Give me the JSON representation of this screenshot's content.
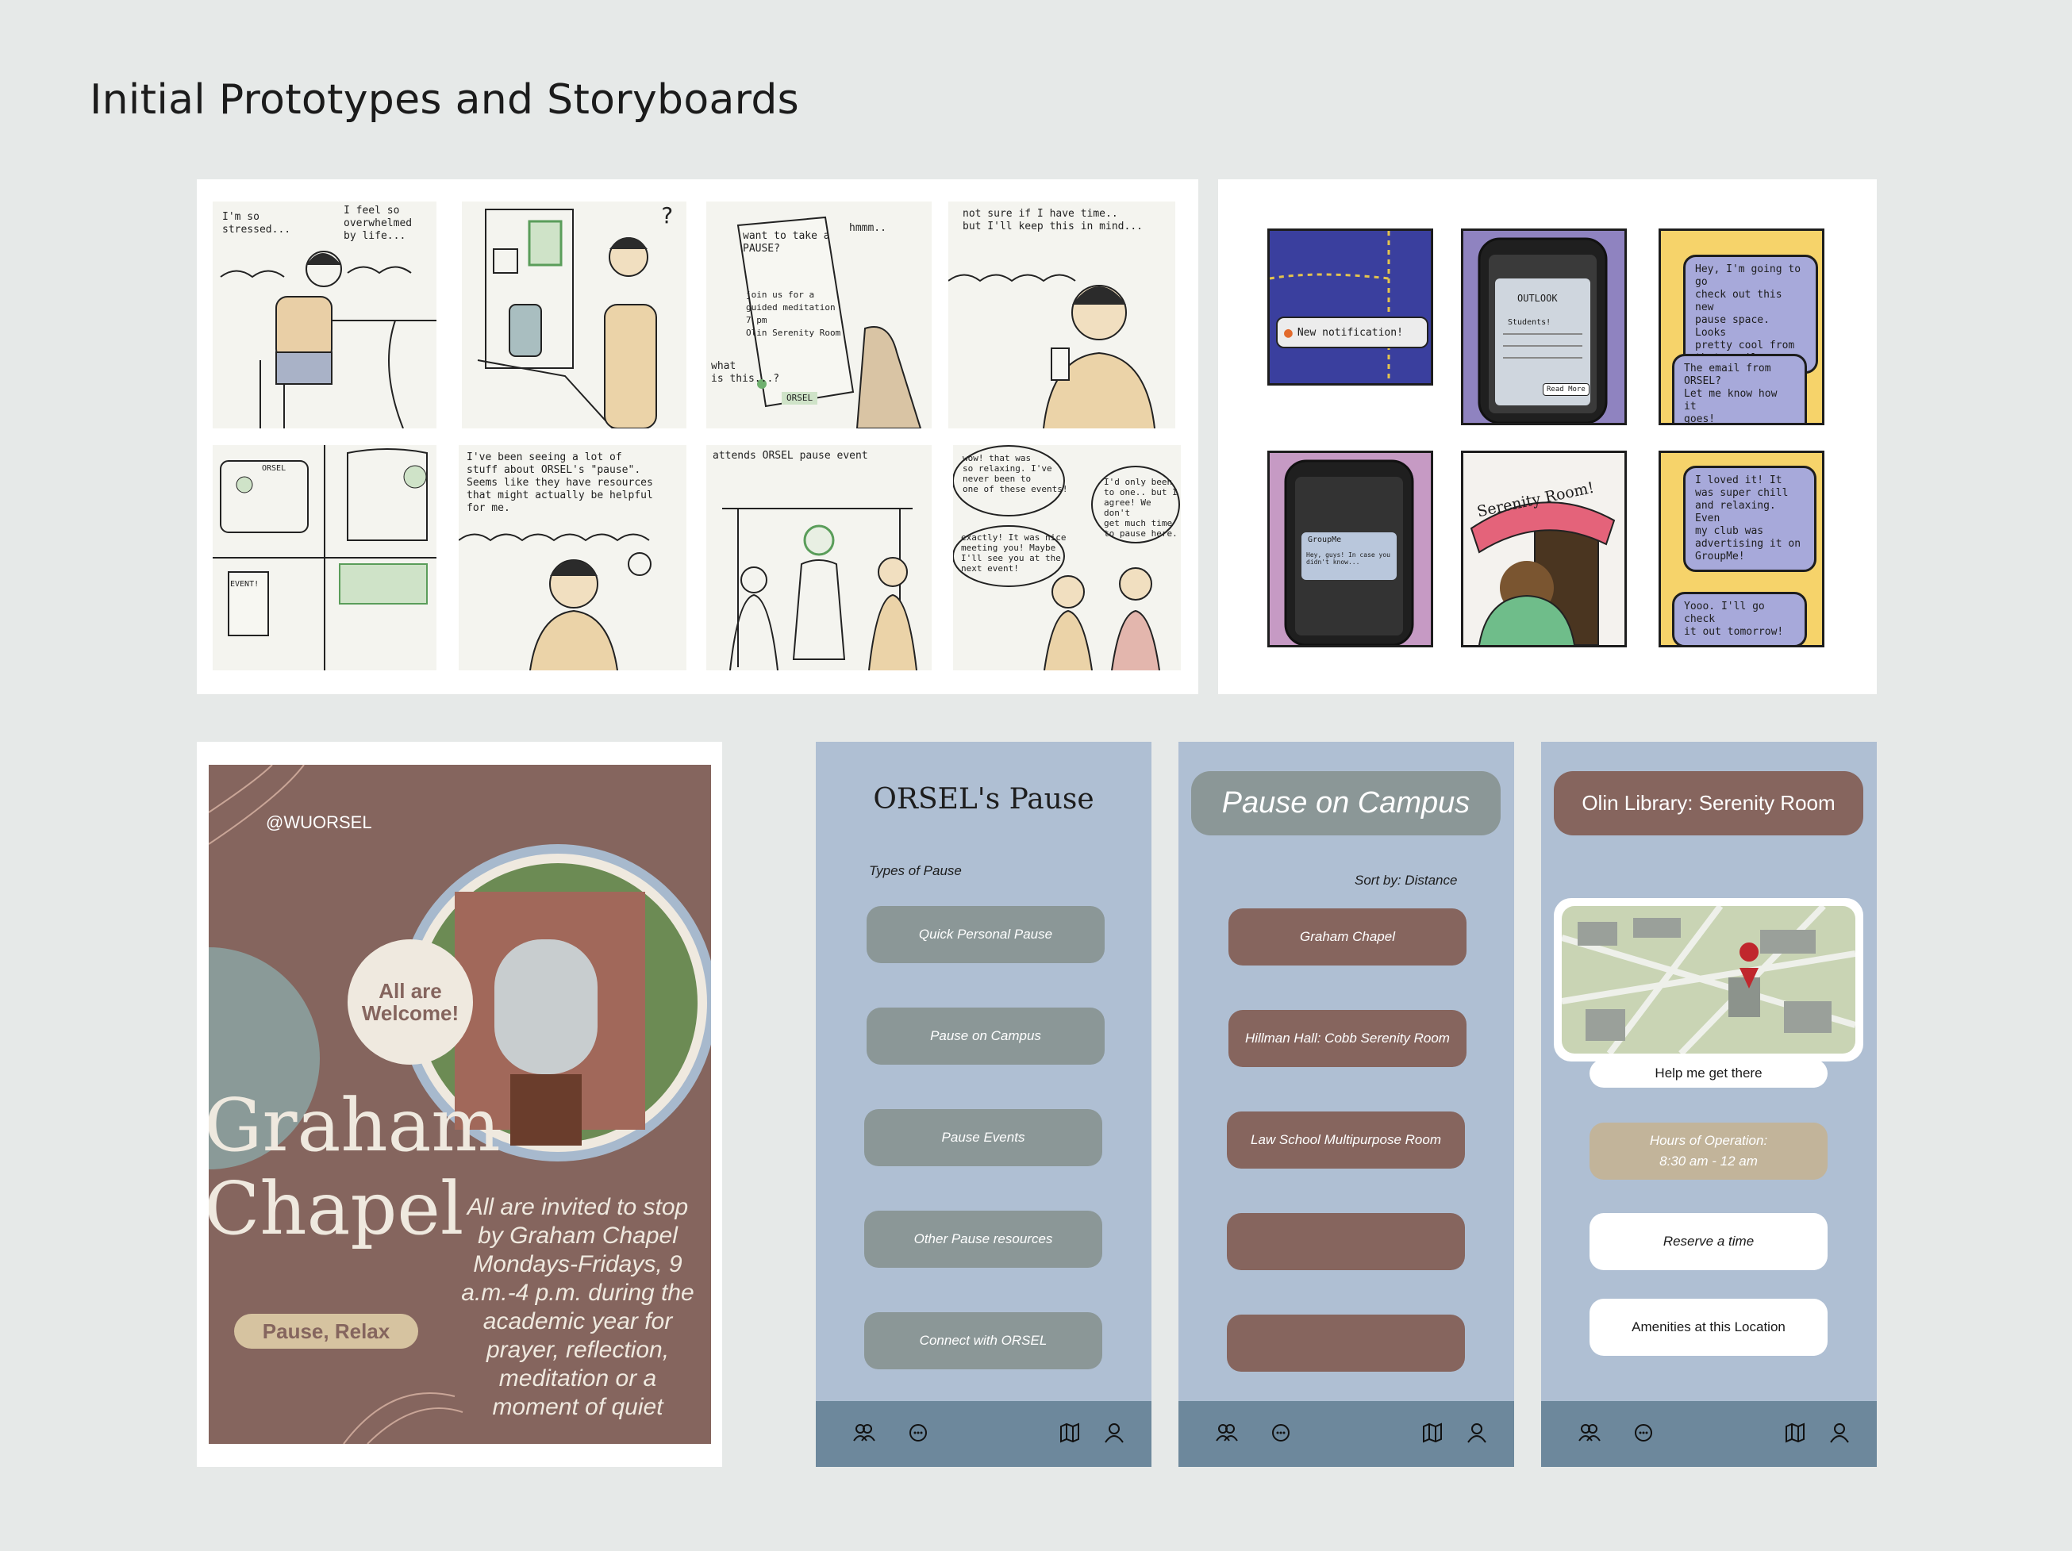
{
  "page": {
    "title": "Initial Prototypes and Storyboards"
  },
  "storyboard": {
    "captions": {
      "c1a": "I'm so\nstressed...",
      "c1b": "I feel so\noverwhelmed\nby life...",
      "c2": "?",
      "c3a": "want to take a\nPAUSE?",
      "c3b": "join us for a\nguided meditation\n7 pm\nOlin Serenity Room",
      "c3c": "hmmm..",
      "c3d": "what\nis this...?",
      "c3tag": "ORSEL",
      "c4": "not sure if I have time..\nbut I'll keep this in mind...",
      "c5a": "ORSEL",
      "c5b": "EVENT!",
      "c6": "I've been seeing a lot of\nstuff about ORSEL's \"pause\".\nSeems like they have resources\nthat might actually be helpful\nfor me.",
      "c7": "attends ORSEL pause event",
      "c8a": "wow! that was\nso relaxing. I've\nnever been to\none of these events!",
      "c8b": "I'd only been\nto one.. but I\nagree! We don't\nget much time\nto pause here.",
      "c8c": "exactly! It was nice\nmeeting you! Maybe\nI'll see you at the\nnext event!"
    }
  },
  "comic": {
    "notification": "New notification!",
    "email_app": "OUTLOOK",
    "email_body": "Students!",
    "read_more": "Read More",
    "groupme": "GroupMe",
    "groupme_msg": "Hey, guys! In case you didn't know...",
    "sign": "Serenity Room!",
    "bubble1": "Hey, I'm going to go\ncheck out this new\npause space. Looks\npretty cool from\nthat email.",
    "bubble2": "The email from ORSEL?\nLet me know how it\ngoes!",
    "bubble3": "I loved it! It\nwas super chill\nand relaxing. Even\nmy club was\nadvertising it on\nGroupMe!",
    "bubble4": "Yooo. I'll go check\nit out tomorrow!"
  },
  "poster": {
    "handle": "@WUORSEL",
    "badge": "All are\nWelcome!",
    "title_line1": "Graham",
    "title_line2": "Chapel",
    "tag": "Pause, Relax",
    "description": "All are invited to stop by Graham Chapel Mondays-Fridays, 9 a.m.-4 p.m. during the academic year for prayer, reflection, meditation or a moment of quiet"
  },
  "phone1": {
    "title": "ORSEL's Pause",
    "section": "Types of Pause",
    "buttons": [
      "Quick Personal Pause",
      "Pause on Campus",
      "Pause Events",
      "Other Pause resources",
      "Connect with ORSEL"
    ]
  },
  "phone2": {
    "title": "Pause on Campus",
    "sort": "Sort by: Distance",
    "locations": [
      "Graham  Chapel",
      "Hillman Hall: Cobb Serenity Room",
      "Law School Multipurpose Room",
      "",
      ""
    ]
  },
  "phone3": {
    "title": "Olin Library: Serenity Room",
    "directions": "Help me get there",
    "hours_label": "Hours of Operation:",
    "hours_value": "8:30 am - 12 am",
    "reserve": "Reserve a time",
    "amenities": "Amenities at this Location"
  },
  "colors": {
    "background": "#e6e9e8",
    "phone_bg": "#afbfd3",
    "navbar": "#6d889c",
    "gray_button": "#8b9797",
    "brown_button": "#86655e",
    "tan_button": "#c2b49a"
  },
  "icons": {
    "nav": [
      "community-icon",
      "chat-icon",
      "map-book-icon",
      "profile-icon"
    ]
  }
}
